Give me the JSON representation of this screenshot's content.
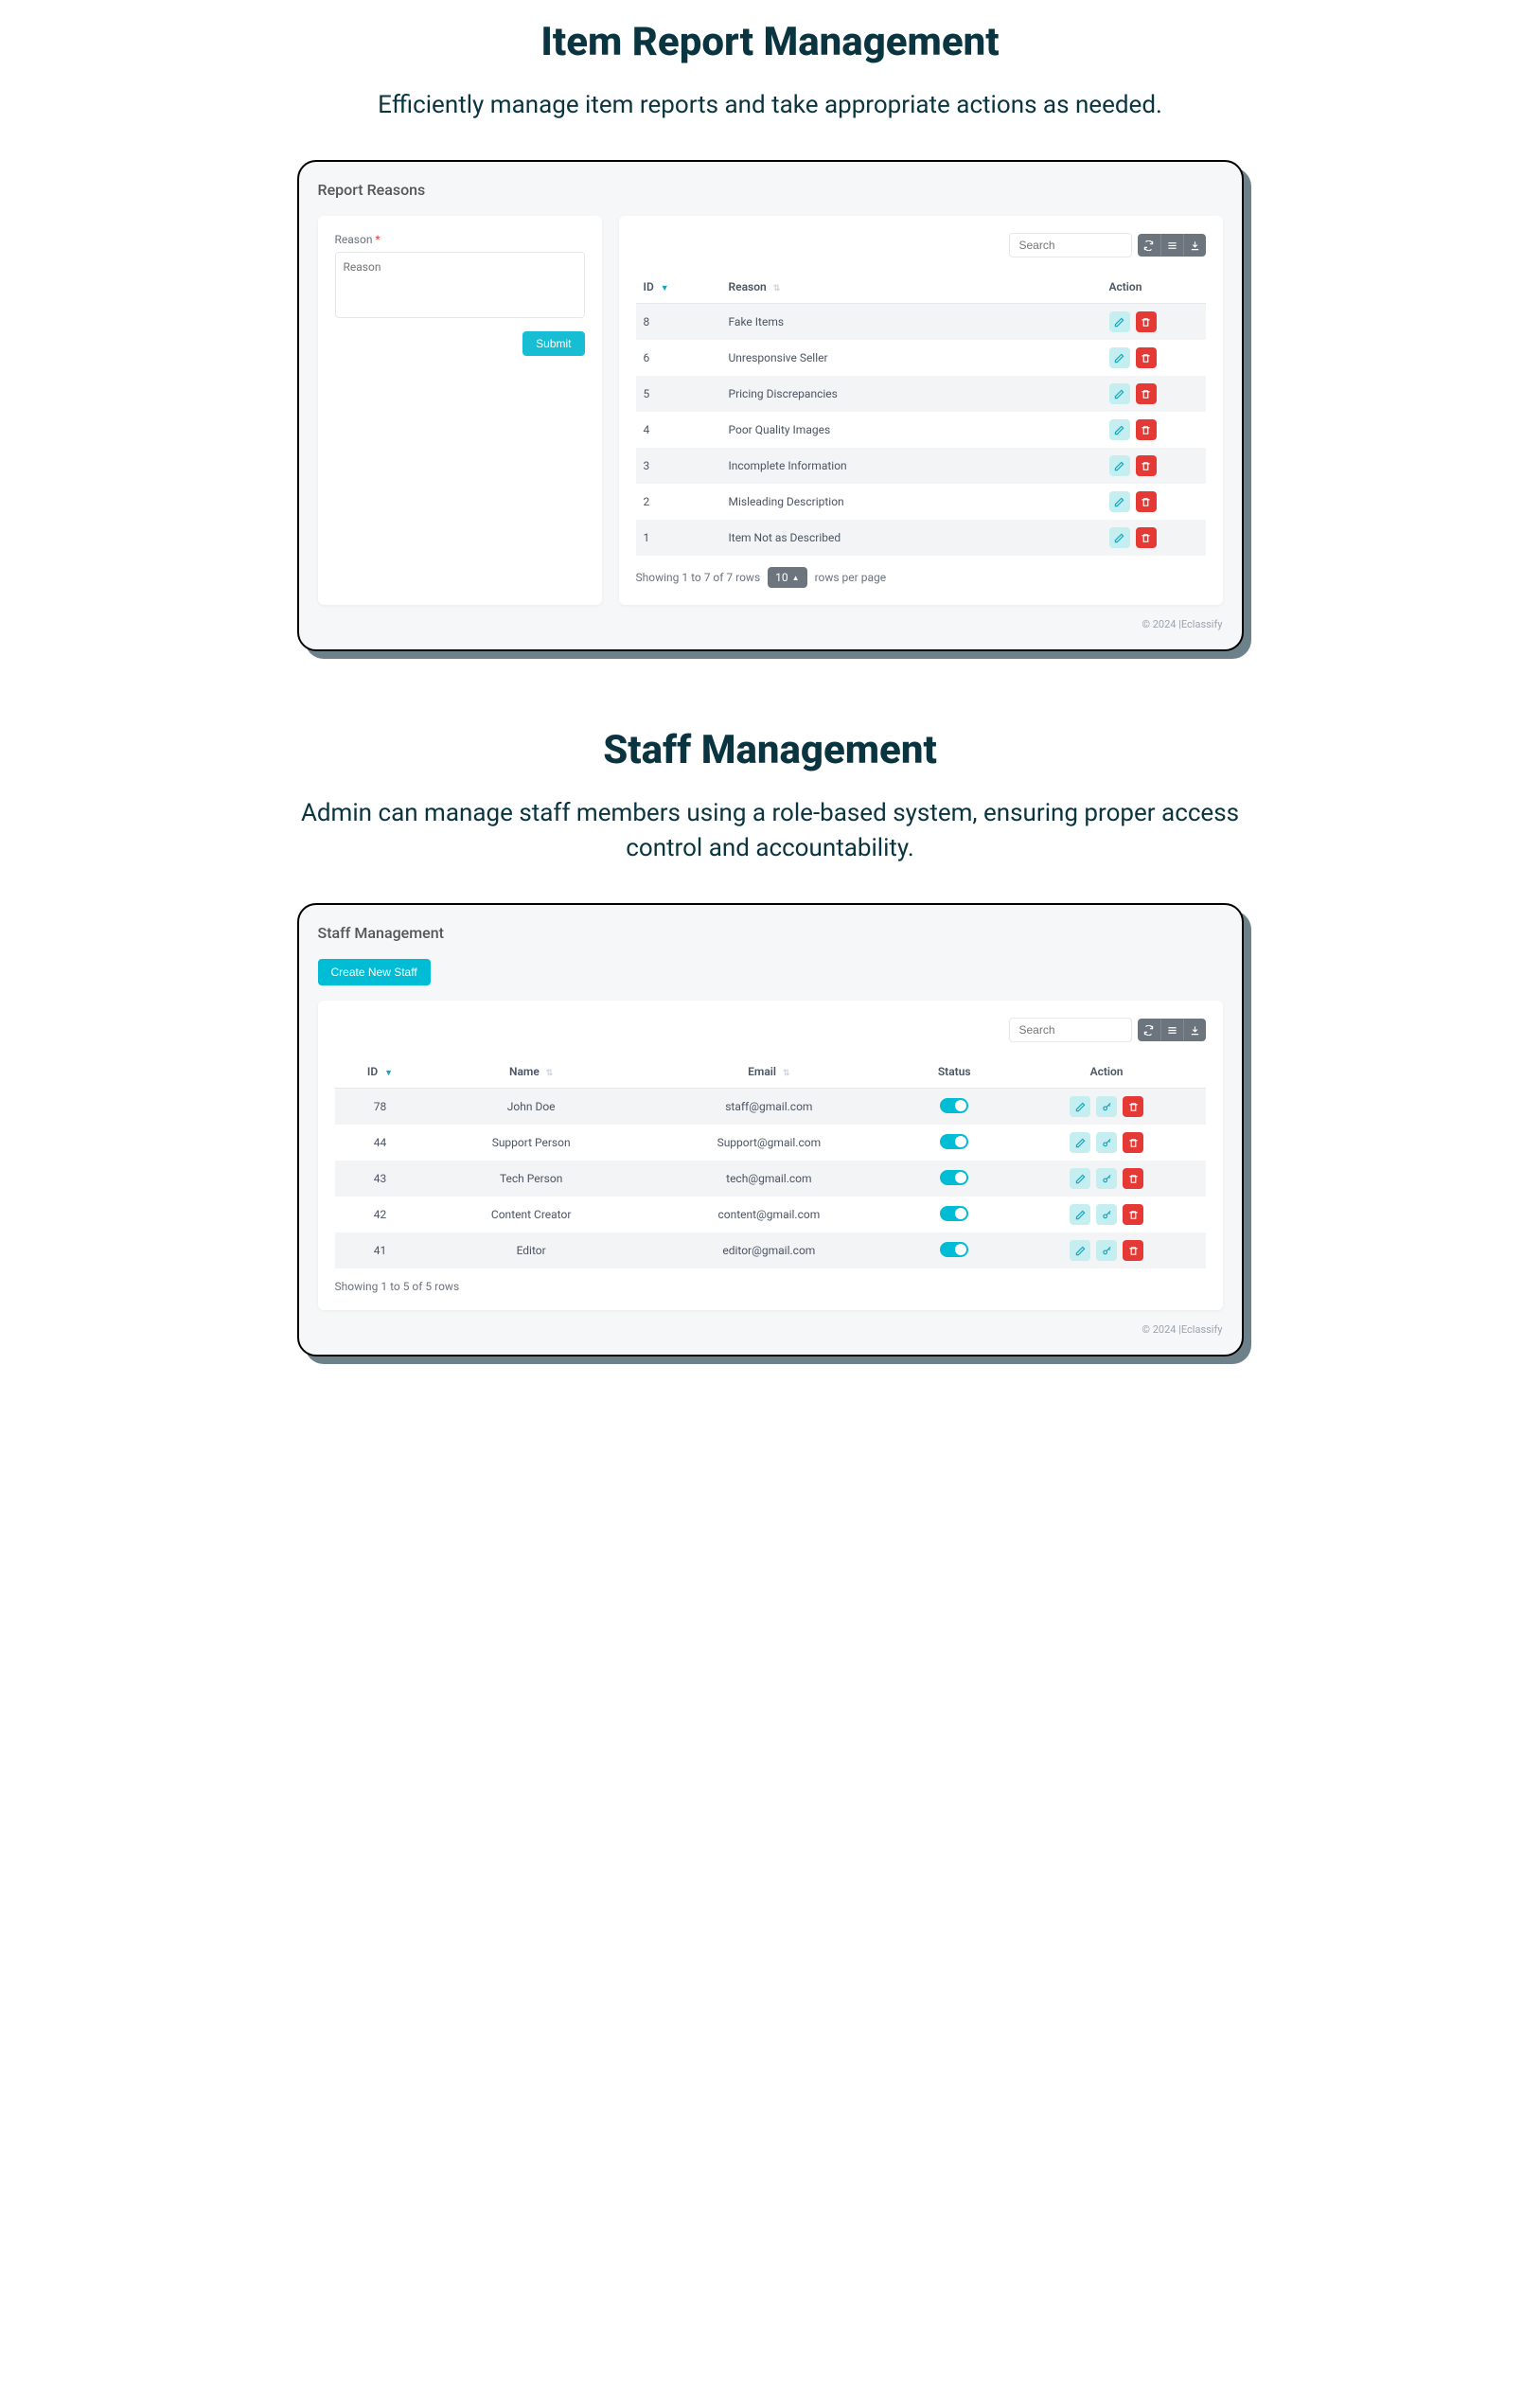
{
  "section1": {
    "title": "Item Report Management",
    "subtitle": "Efficiently manage item reports and take appropriate actions as needed.",
    "panel_title": "Report Reasons",
    "form": {
      "label": "Reason",
      "required": "*",
      "placeholder": "Reason",
      "submit": "Submit"
    },
    "search_placeholder": "Search",
    "columns": {
      "id": "ID",
      "reason": "Reason",
      "action": "Action"
    },
    "rows": [
      {
        "id": "8",
        "reason": "Fake Items"
      },
      {
        "id": "6",
        "reason": "Unresponsive Seller"
      },
      {
        "id": "5",
        "reason": "Pricing Discrepancies"
      },
      {
        "id": "4",
        "reason": "Poor Quality Images"
      },
      {
        "id": "3",
        "reason": "Incomplete Information"
      },
      {
        "id": "2",
        "reason": "Misleading Description"
      },
      {
        "id": "1",
        "reason": "Item Not as Described"
      }
    ],
    "pager": {
      "showing": "Showing 1 to 7 of 7 rows",
      "page_size": "10",
      "suffix": "rows per page"
    },
    "copyright": "© 2024 |Eclassify"
  },
  "section2": {
    "title": "Staff Management",
    "subtitle": "Admin can manage staff members using a role-based system, ensuring proper access control and accountability.",
    "panel_title": "Staff Management",
    "create_btn": "Create New Staff",
    "search_placeholder": "Search",
    "columns": {
      "id": "ID",
      "name": "Name",
      "email": "Email",
      "status": "Status",
      "action": "Action"
    },
    "rows": [
      {
        "id": "78",
        "name": "John Doe",
        "email": "staff@gmail.com"
      },
      {
        "id": "44",
        "name": "Support Person",
        "email": "Support@gmail.com"
      },
      {
        "id": "43",
        "name": "Tech Person",
        "email": "tech@gmail.com"
      },
      {
        "id": "42",
        "name": "Content Creator",
        "email": "content@gmail.com"
      },
      {
        "id": "41",
        "name": "Editor",
        "email": "editor@gmail.com"
      }
    ],
    "pager": {
      "showing": "Showing 1 to 5 of 5 rows"
    },
    "copyright": "© 2024 |Eclassify"
  }
}
